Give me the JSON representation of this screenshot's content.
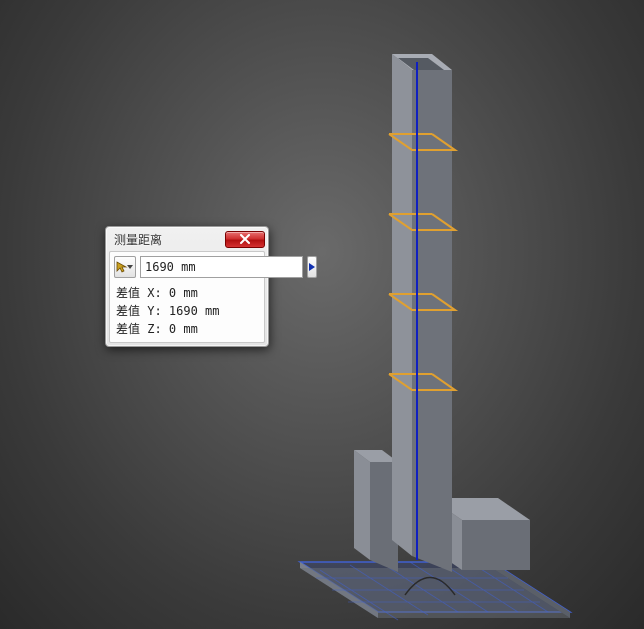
{
  "dialog": {
    "title": "测量距离",
    "measure_value": "1690 mm",
    "dx_label": "差值 X:",
    "dy_label": "差值 Y:",
    "dz_label": "差值 Z:",
    "dx_value": "0 mm",
    "dy_value": "1690 mm",
    "dz_value": "0 mm"
  },
  "model": {
    "tower_height_mm": 1690,
    "ring_color": "#e0a030",
    "measure_line_color": "#1020c0",
    "baseplate_highlight": "#4060d0"
  }
}
